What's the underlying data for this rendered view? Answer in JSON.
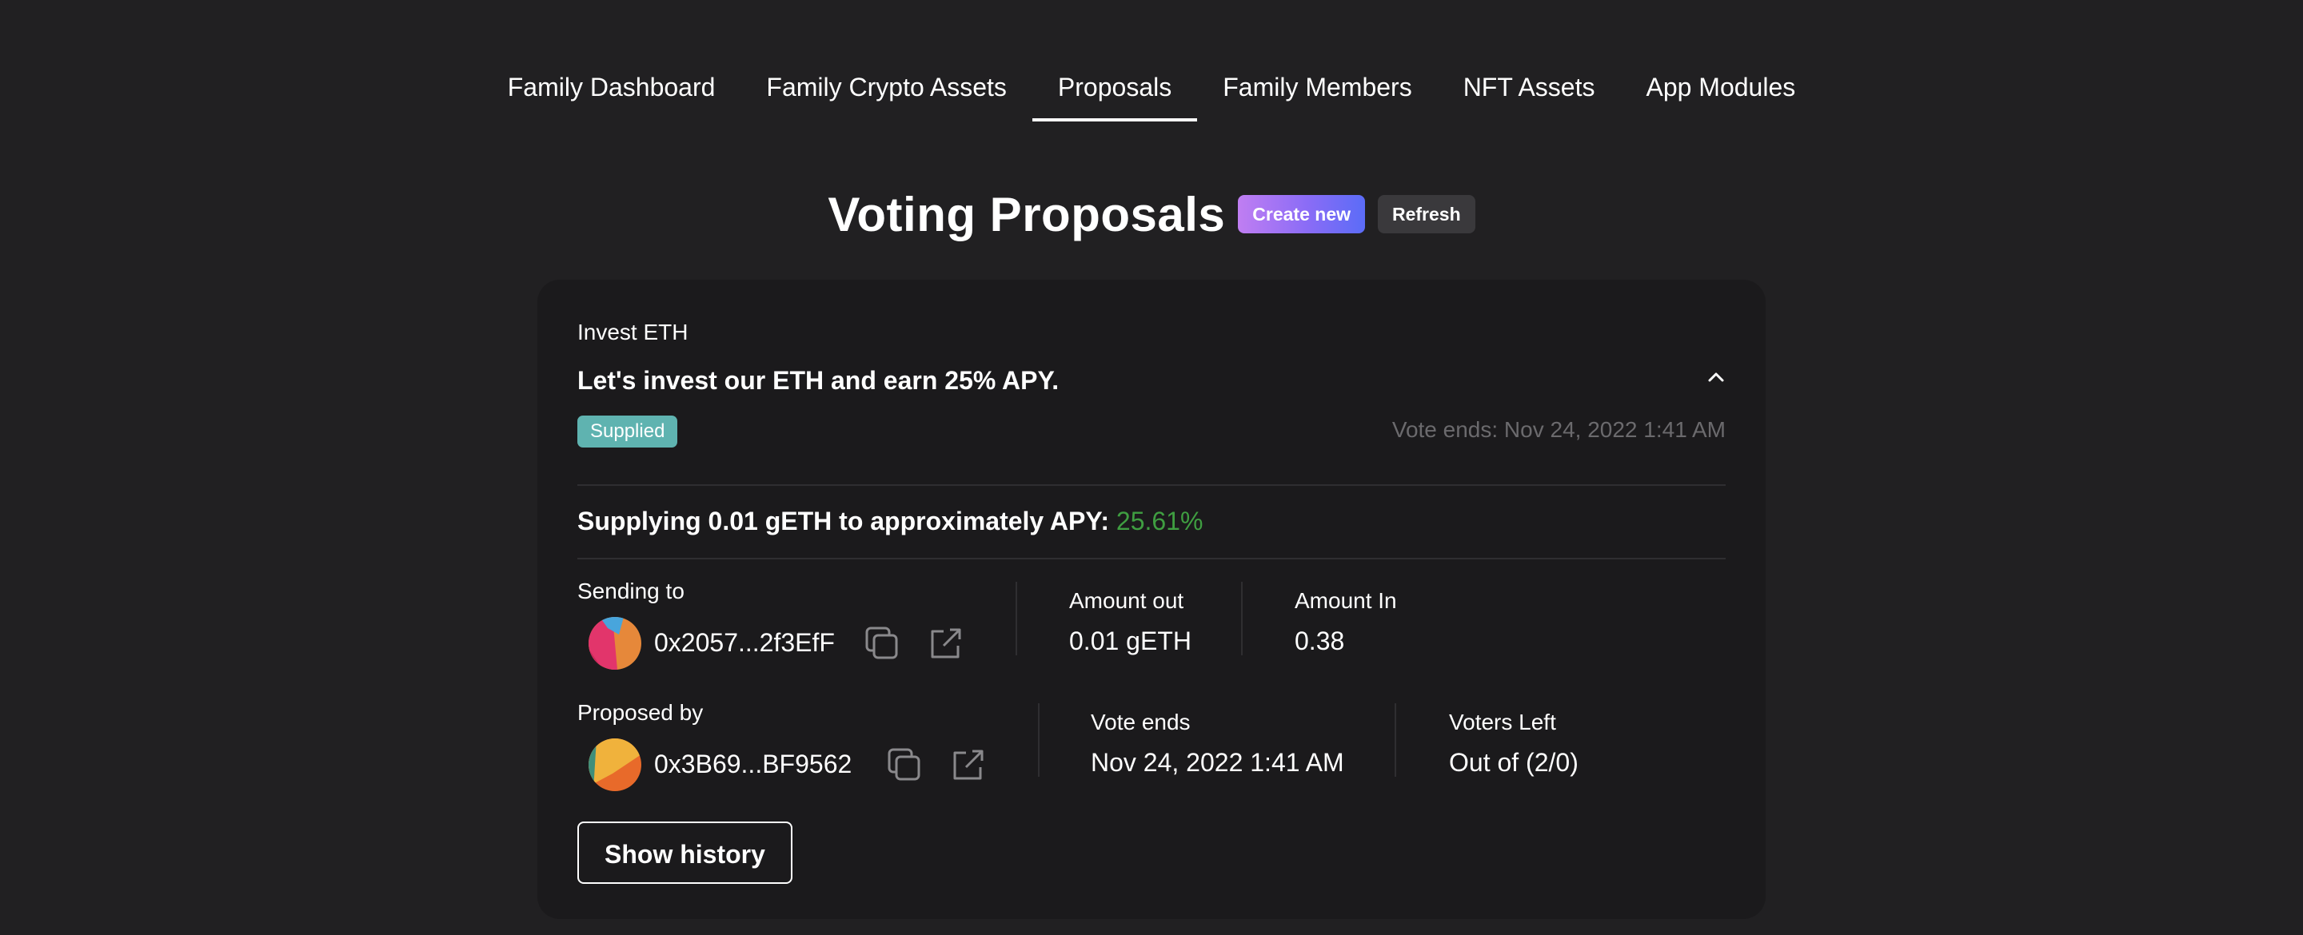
{
  "nav": {
    "tabs": [
      {
        "label": "Family Dashboard"
      },
      {
        "label": "Family Crypto Assets"
      },
      {
        "label": "Proposals"
      },
      {
        "label": "Family Members"
      },
      {
        "label": "NFT Assets"
      },
      {
        "label": "App Modules"
      }
    ],
    "active_tab": "Proposals"
  },
  "header": {
    "title": "Voting Proposals",
    "create_label": "Create new",
    "refresh_label": "Refresh"
  },
  "proposal": {
    "category": "Invest ETH",
    "title": "Let's invest our ETH and earn 25% APY.",
    "status_badge": "Supplied",
    "vote_ends_summary": "Vote ends: Nov 24, 2022 1:41 AM",
    "supply_text": "Supplying 0.01 gETH to approximately APY:",
    "supply_apy": "25.61%",
    "sending_to_label": "Sending to",
    "sending_to_address": "0x2057...2f3EfF",
    "amount_out_label": "Amount out",
    "amount_out_value": "0.01 gETH",
    "amount_in_label": "Amount In",
    "amount_in_value": "0.38",
    "proposed_by_label": "Proposed by",
    "proposed_by_address": "0x3B69...BF9562",
    "vote_ends_label": "Vote ends",
    "vote_ends_value": "Nov 24, 2022 1:41 AM",
    "voters_left_label": "Voters Left",
    "voters_left_value": "Out of (2/0)",
    "show_history_label": "Show history"
  },
  "colors": {
    "background": "#212022",
    "card": "#1b1a1c",
    "badge": "#5fb3b0",
    "apy_green": "#3f9e41",
    "muted": "#6b6a6d",
    "create_gradient_start": "#c07ef2",
    "create_gradient_end": "#5b6cf7"
  },
  "icons": {
    "collapse": "chevron-up-icon",
    "copy": "copy-icon",
    "external": "external-link-icon"
  }
}
